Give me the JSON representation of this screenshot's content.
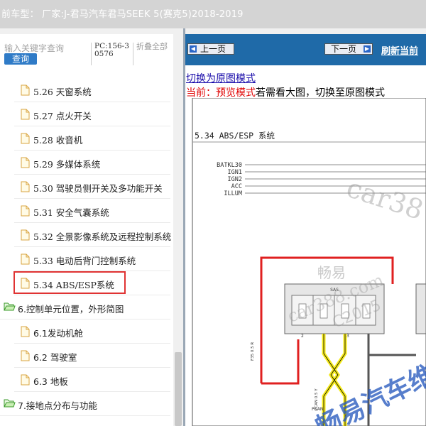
{
  "window": {
    "title": "前车型： 厂家:J-君马汽车君马SEEK 5(赛克5)2018-2019"
  },
  "search": {
    "placeholder": "输入关键字查询",
    "button_label": "查询",
    "pc_label": "PC:156-30576",
    "collapse_label": "折叠全部"
  },
  "tree": {
    "items": [
      {
        "label": "5.26 天窗系统"
      },
      {
        "label": "5.27 点火开关"
      },
      {
        "label": "5.28 收音机"
      },
      {
        "label": "5.29 多媒体系统"
      },
      {
        "label": "5.30 驾驶员侧开关及多功能开关"
      },
      {
        "label": "5.31 安全气囊系统"
      },
      {
        "label": "5.32 全景影像系统及远程控制系统"
      },
      {
        "label": "5.33 电动后背门控制系统"
      },
      {
        "label": "5.34 ABS/ESP系统"
      },
      {
        "label": "6.控制单元位置，外形简图"
      },
      {
        "label": "6.1发动机舱"
      },
      {
        "label": "6.2 驾驶室"
      },
      {
        "label": "6.3 地板"
      },
      {
        "label": "7.接地点分布与功能"
      }
    ]
  },
  "nav": {
    "prev_label": "上一页",
    "next_label": "下一页",
    "refresh_label": "刷新当前"
  },
  "content": {
    "switch_link": "切换为原图模式",
    "status_prefix": "当前：预览模式",
    "status_suffix": "若需看大图，切换至原图模式"
  },
  "diagram": {
    "section_title": "5.34 ABS/ESP 系统",
    "bus_labels": [
      "BATKL30",
      "IGN1",
      "IGN2",
      "ACC",
      "ILLUM"
    ],
    "connector_label": "SAS",
    "pin_numbers": [
      "2",
      "3"
    ],
    "bottom_label": "PCAN",
    "wire_label_a": "F35 0.5 R",
    "wire_label_b": "PCAN 0.5 Y"
  },
  "watermarks": {
    "w1": "car38",
    "w2": "畅易",
    "w3": "car388.com",
    "w4": "C2015",
    "w5": "畅易汽车维"
  },
  "colors": {
    "nav_bg": "#1f6aa8",
    "highlight": "#e03333",
    "wire_red": "#e02020",
    "wire_yellow": "#f5ea1a",
    "link": "#1a0dab"
  }
}
